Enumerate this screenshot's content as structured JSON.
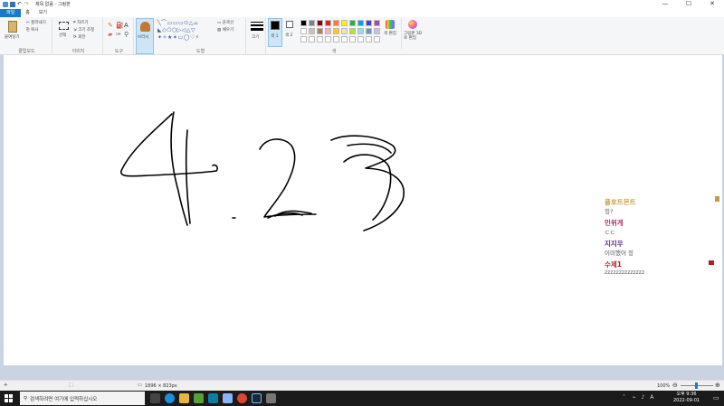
{
  "titlebar": {
    "title": "제목 없음 - 그림판",
    "minimize": "—",
    "maximize": "☐",
    "close": "✕"
  },
  "menu": {
    "file": "파일",
    "home": "홈",
    "view": "보기"
  },
  "ribbon": {
    "clipboard": {
      "paste": "붙여넣기",
      "cut": "잘라내기",
      "copy": "복사",
      "label": "클립보드"
    },
    "image": {
      "select": "선택",
      "crop": "자르기",
      "resize": "크기 조정",
      "rotate": "회전",
      "label": "이미지"
    },
    "tools": {
      "label": "도구"
    },
    "brushes": {
      "label": "브러시"
    },
    "shapes": {
      "outline": "윤곽선",
      "fill": "채우기",
      "label": "도형"
    },
    "size": {
      "label": "크기"
    },
    "color1": "색 1",
    "color2": "색 2",
    "colors": {
      "label": "색",
      "edit": "색 편집"
    },
    "paint3d": "그림판 3D로 편집",
    "palette": [
      "#000000",
      "#7f7f7f",
      "#880015",
      "#ed1c24",
      "#ff7f27",
      "#fff200",
      "#22b14c",
      "#00a2e8",
      "#3f48cc",
      "#a349a4",
      "#ffffff",
      "#c3c3c3",
      "#b97a57",
      "#ffaec9",
      "#ffc90e",
      "#efe4b0",
      "#b5e61d",
      "#99d9ea",
      "#7092be",
      "#c8bfe7"
    ]
  },
  "overlay": [
    {
      "name": "플호트몬트",
      "color": "#c9a24a",
      "sub": "힝?"
    },
    {
      "name": "인위게",
      "color": "#b0306a",
      "sub": "ㄷㄷ"
    },
    {
      "name": "지지우",
      "color": "#5b2a86",
      "sub": "이미했어 힝"
    },
    {
      "name": "수제1",
      "color": "#b01e1e",
      "sub": "zzzzzzzzzzzzzz"
    }
  ],
  "status": {
    "size": "1896 × 823px",
    "zoom": "100%"
  },
  "taskbar": {
    "search_placeholder": "검색하려면 여기에 입력하십시오",
    "time": "오후 9:36",
    "date": "2022-09-01",
    "lang": "A"
  }
}
